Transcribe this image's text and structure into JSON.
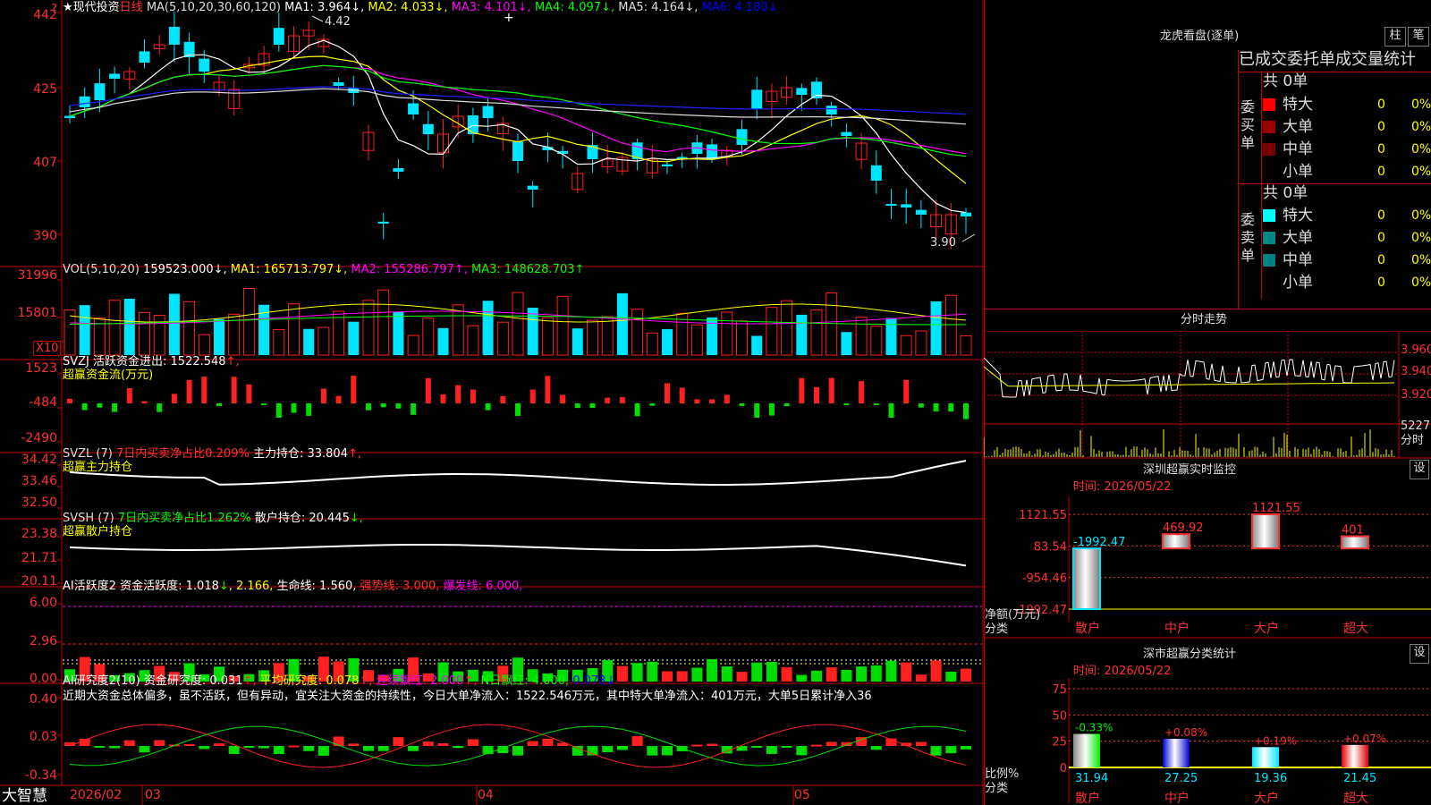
{
  "main": {
    "title": "★现代投资",
    "period": "日线",
    "ma_line": [
      {
        "text": "MA(5,10,20,30,60,120)",
        "color": "#dddddd"
      },
      {
        "text": " MA1: 3.964↓,",
        "color": "#ffffff"
      },
      {
        "text": " MA2: 4.033↓,",
        "color": "#ffff00"
      },
      {
        "text": " MA3: 4.101↓,",
        "color": "#ff00ff"
      },
      {
        "text": " MA4: 4.097↓,",
        "color": "#00ff00"
      },
      {
        "text": " MA5: 4.164↓,",
        "color": "#dddddd"
      },
      {
        "text": " MA6: 4.180↓",
        "color": "#0000ff"
      }
    ],
    "y_labels": [
      "442",
      "425",
      "407",
      "390"
    ],
    "high_label": "4.42",
    "low_label": "3.90"
  },
  "vol": {
    "header": [
      {
        "text": "VOL(5,10,20) ",
        "color": "#dddddd"
      },
      {
        "text": "159523.000↓,",
        "color": "#ffffff"
      },
      {
        "text": " MA1: 165713.797↓,",
        "color": "#ffff00"
      },
      {
        "text": " MA2: 155286.797↑,",
        "color": "#ff00ff"
      },
      {
        "text": " MA3: 148628.703↑",
        "color": "#00ff00"
      }
    ],
    "y_labels": [
      "31996",
      "15801"
    ],
    "unit": "X10"
  },
  "svzj": {
    "header": [
      {
        "text": "SVZJ  活跃资金进出: 1522.548",
        "color": "#ffffff"
      },
      {
        "text": "↑,",
        "color": "#ff3030"
      }
    ],
    "sub": "超赢资金流(万元)",
    "y_labels": [
      "1523",
      "-484",
      "-2490"
    ]
  },
  "svzl": {
    "header": [
      {
        "text": "SVZL (7) ",
        "color": "#dddddd"
      },
      {
        "text": "7日内买卖净占比0.209%",
        "color": "#ff3030"
      },
      {
        "text": " 主力持仓: 33.804",
        "color": "#ffffff"
      },
      {
        "text": "↑,",
        "color": "#ff3030"
      }
    ],
    "sub": "超赢主力持仓",
    "y_labels": [
      "34.42",
      "33.46",
      "32.50"
    ]
  },
  "svsh": {
    "header": [
      {
        "text": "SVSH (7) ",
        "color": "#dddddd"
      },
      {
        "text": "7日内买卖净占比1.262%",
        "color": "#00ff00"
      },
      {
        "text": " 散户持仓: 20.445",
        "color": "#ffffff"
      },
      {
        "text": "↓,",
        "color": "#00ff00"
      }
    ],
    "sub": "超赢散户持仓",
    "y_labels": [
      "23.38",
      "21.71",
      "20.11"
    ]
  },
  "ai_active": {
    "header": [
      {
        "text": "AI活跃度2 资金活跃度: 1.018",
        "color": "#ffffff"
      },
      {
        "text": "↓",
        "color": "#00ff00"
      },
      {
        "text": ", 2.166,",
        "color": "#ffff00"
      },
      {
        "text": " 生命线: 1.560,",
        "color": "#ffffff"
      },
      {
        "text": " 强势线: 3.000,",
        "color": "#ff3030"
      },
      {
        "text": " 爆发线: 6.000,",
        "color": "#ff00ff"
      }
    ],
    "y_labels": [
      "6.00",
      "2.96",
      "0.00"
    ]
  },
  "ai_research": {
    "header": [
      {
        "text": "AI研究度2(10) 资金研究度: 0.031",
        "color": "#ffffff"
      },
      {
        "text": "↑,",
        "color": "#ff3030"
      },
      {
        "text": " 平均研究度: 0.078",
        "color": "#ffff00"
      },
      {
        "text": "↑,",
        "color": "#ff3030"
      },
      {
        "text": " 连续飘红: 2.000",
        "color": "#ff00ff"
      },
      {
        "text": "↑,",
        "color": "#ff3030"
      },
      {
        "text": " N日飘红: 4.000,",
        "color": "#00ff00"
      },
      {
        "text": " 0.078↓",
        "color": "#0000ff"
      }
    ],
    "comment": "近期大资金总体偏多，虽不活跃，但有异动，宜关注大资金的持续性，今日大单净流入：1522.546万元，其中特大单净流入：401万元，大单5日累计净入36",
    "y_labels": [
      "0.40",
      "0.03",
      "-0.34"
    ]
  },
  "xaxis": {
    "labels": [
      "2026/02",
      "03",
      "04",
      "05"
    ],
    "brand": "大智慧"
  },
  "dragon": {
    "title": "龙虎看盘(逐单)",
    "tab1": "柱",
    "tab2": "笔",
    "subtitle": "已成交委托单成交量统计",
    "buy_title": "委买单",
    "sell_title": "委卖单",
    "buy_total": "共 0单",
    "sell_total": "共 0单",
    "buy_rows": [
      {
        "name": "特大",
        "count": "0",
        "pct": "0%",
        "color": "#ff0000"
      },
      {
        "name": "大单",
        "count": "0",
        "pct": "0%",
        "color": "#990000"
      },
      {
        "name": "中单",
        "count": "0",
        "pct": "0%",
        "color": "#770000"
      },
      {
        "name": "小单",
        "count": "0",
        "pct": "0%",
        "color": ""
      }
    ],
    "sell_rows": [
      {
        "name": "特大",
        "count": "0",
        "pct": "0%",
        "color": "#00ffff"
      },
      {
        "name": "大单",
        "count": "0",
        "pct": "0%",
        "color": "#008888"
      },
      {
        "name": "中单",
        "count": "0",
        "pct": "0%",
        "color": "#008080"
      },
      {
        "name": "小单",
        "count": "0",
        "pct": "0%",
        "color": ""
      }
    ]
  },
  "intraday": {
    "title": "分时走势",
    "y_labels": [
      "3.960",
      "3.940",
      "3.920"
    ],
    "vol_label": "5227",
    "unit": "分时"
  },
  "monitor": {
    "title": "深圳超赢实时监控",
    "settings": "设",
    "time": "时间: 2026/05/22",
    "y_labels": [
      "1121.55",
      "83.54",
      "-954.46",
      "-1992.47"
    ],
    "ylabel": "净额(万元)",
    "xlabel": "分类",
    "categories": [
      "散户",
      "中户",
      "大户",
      "超大"
    ],
    "values": [
      -1992.47,
      469.92,
      1121.55,
      401
    ],
    "value_labels": [
      "-1992.47",
      "469.92",
      "1121.55",
      "401"
    ]
  },
  "classify": {
    "title": "深市超赢分类统计",
    "settings": "设",
    "time": "时间: 2026/05/22",
    "y_labels": [
      "75",
      "50",
      "25",
      "0"
    ],
    "ylabel": "比例%",
    "xlabel": "分类",
    "categories": [
      "散户",
      "中户",
      "大户",
      "超大"
    ],
    "values": [
      31.94,
      27.25,
      19.36,
      21.45
    ],
    "changes": [
      "-0.33%",
      "+0.08%",
      "+0.19%",
      "+0.07%"
    ]
  },
  "chart_data": [
    {
      "type": "candlestick",
      "title": "现代投资 日线",
      "x": [
        "2026/02",
        "03",
        "04",
        "05"
      ],
      "ylim": [
        3.9,
        4.42
      ],
      "high": 4.42,
      "low": 3.9,
      "ma": {
        "MA1": 3.964,
        "MA2": 4.033,
        "MA3": 4.101,
        "MA4": 4.097,
        "MA5": 4.164,
        "MA6": 4.18
      }
    },
    {
      "type": "bar",
      "title": "VOL(5,10,20)",
      "latest": 159523.0,
      "ma": {
        "MA1": 165713.797,
        "MA2": 155286.797,
        "MA3": 148628.703
      }
    },
    {
      "type": "bar",
      "title": "深圳超赢实时监控",
      "categories": [
        "散户",
        "中户",
        "大户",
        "超大"
      ],
      "values": [
        -1992.47,
        469.92,
        1121.55,
        401
      ],
      "ylabel": "净额(万元)"
    },
    {
      "type": "bar",
      "title": "深市超赢分类统计",
      "categories": [
        "散户",
        "中户",
        "大户",
        "超大"
      ],
      "values": [
        31.94,
        27.25,
        19.36,
        21.45
      ],
      "changes": [
        "-0.33%",
        "+0.08%",
        "+0.19%",
        "+0.07%"
      ],
      "ylabel": "比例%",
      "ylim": [
        0,
        75
      ]
    }
  ]
}
